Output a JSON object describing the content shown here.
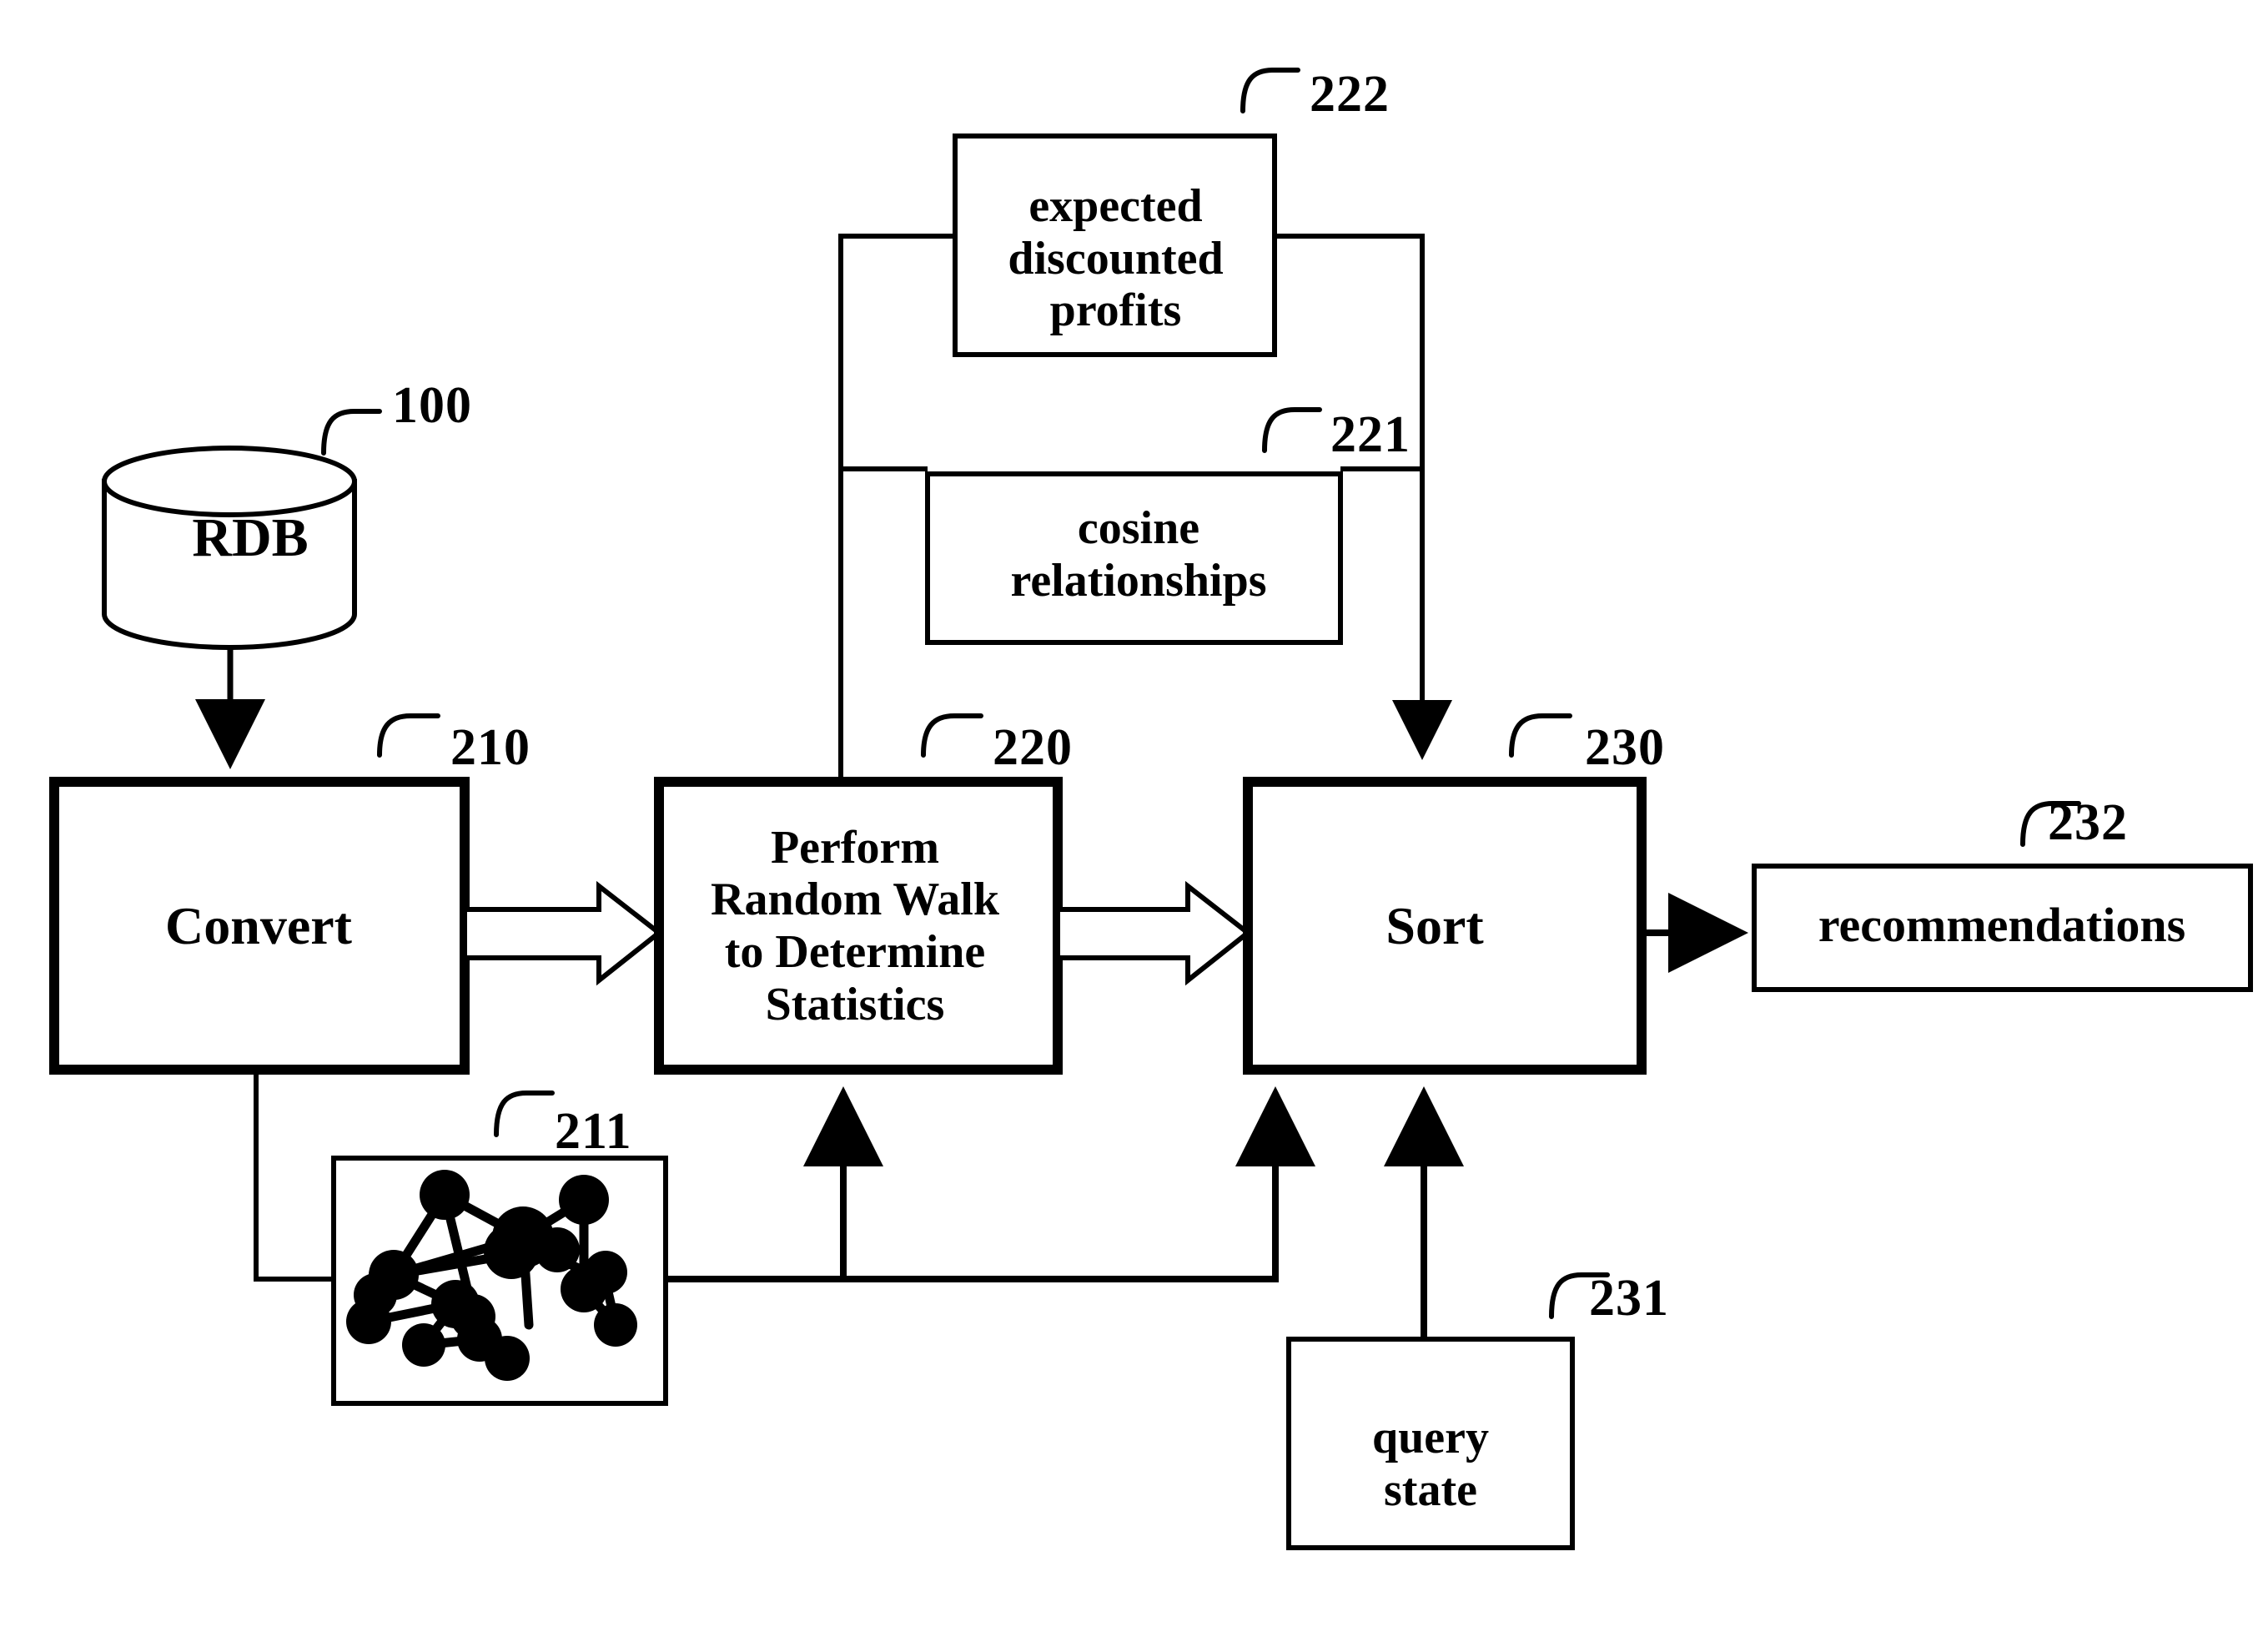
{
  "figure": {
    "type": "patent-flow-diagram",
    "background_color": "#ffffff",
    "line_color": "#000000"
  },
  "nodes": {
    "rdb": {
      "label": "RDB",
      "ref": "100",
      "shape": "cylinder-database"
    },
    "convert": {
      "label": "Convert",
      "ref": "210",
      "shape": "thick-rectangle"
    },
    "graph": {
      "label": "",
      "ref": "211",
      "shape": "thin-rectangle-with-network-graph"
    },
    "random_walk": {
      "label": "Perform\nRandom Walk\nto Determine\nStatistics",
      "ref": "220",
      "shape": "thick-rectangle"
    },
    "cosine": {
      "label": "cosine\nrelationships",
      "ref": "221",
      "shape": "thin-rectangle"
    },
    "expected_profits": {
      "label": "expected\ndiscounted\nprofits",
      "ref": "222",
      "shape": "thin-rectangle"
    },
    "sort": {
      "label": "Sort",
      "ref": "230",
      "shape": "thick-rectangle"
    },
    "query_state": {
      "label": "query\nstate",
      "ref": "231",
      "shape": "thin-rectangle"
    },
    "recommendations": {
      "label": "recommendations",
      "ref": "232",
      "shape": "thin-rectangle"
    }
  },
  "connections": [
    {
      "from": "rdb",
      "to": "convert",
      "style": "solid-arrow-down"
    },
    {
      "from": "convert",
      "to": "random_walk",
      "style": "hollow-block-arrow-right"
    },
    {
      "from": "convert",
      "to": "graph",
      "style": "plain-line"
    },
    {
      "from": "graph",
      "to": "random_walk",
      "style": "solid-arrow-up"
    },
    {
      "from": "graph",
      "to": "sort",
      "style": "solid-arrow-up"
    },
    {
      "from": "random_walk",
      "to": "expected_profits",
      "style": "plain-line"
    },
    {
      "from": "random_walk",
      "to": "cosine",
      "style": "plain-line"
    },
    {
      "from": "expected_profits",
      "to": "sort",
      "style": "solid-arrow-down"
    },
    {
      "from": "cosine",
      "to": "sort",
      "style": "solid-arrow-down"
    },
    {
      "from": "random_walk",
      "to": "sort",
      "style": "hollow-block-arrow-right"
    },
    {
      "from": "query_state",
      "to": "sort",
      "style": "solid-arrow-up"
    },
    {
      "from": "sort",
      "to": "recommendations",
      "style": "solid-arrow-right"
    }
  ],
  "graph_illustration": {
    "node_count": 16,
    "edge_count": 16,
    "node_color": "#000000",
    "edge_color": "#000000"
  }
}
